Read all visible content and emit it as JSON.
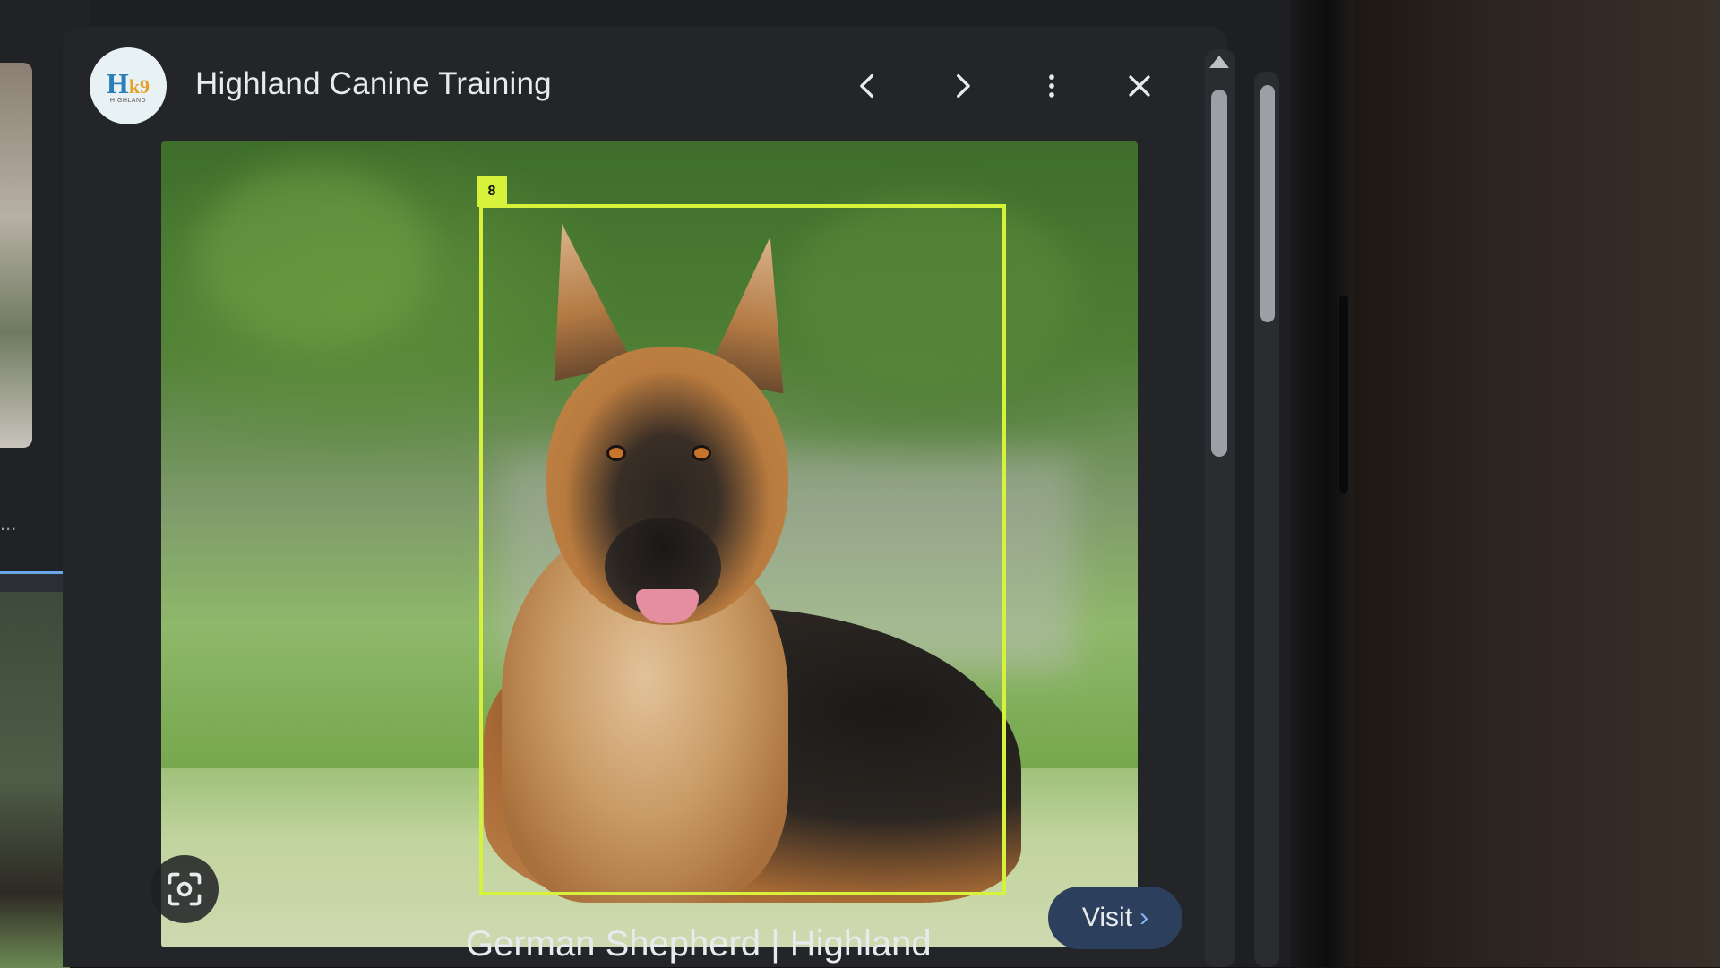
{
  "header": {
    "site_title": "Highland Canine Training",
    "logo_text": "Hk9",
    "logo_sub": "HIGHLAND"
  },
  "controls": {
    "prev_icon": "chevron-left-icon",
    "next_icon": "chevron-right-icon",
    "more_icon": "more-vert-icon",
    "close_icon": "close-icon",
    "lens_icon": "lens-icon"
  },
  "image": {
    "annotation_label": "8"
  },
  "caption": "German Shepherd | Highland",
  "visit": {
    "label": "Visit",
    "chevron": "›"
  },
  "left_results": {
    "ellipsis": "..."
  },
  "colors": {
    "panel_bg": "#232528",
    "annotation": "#d7f23a",
    "visit_bg": "#2c3f5c",
    "selection_border": "#6aa7e8"
  }
}
